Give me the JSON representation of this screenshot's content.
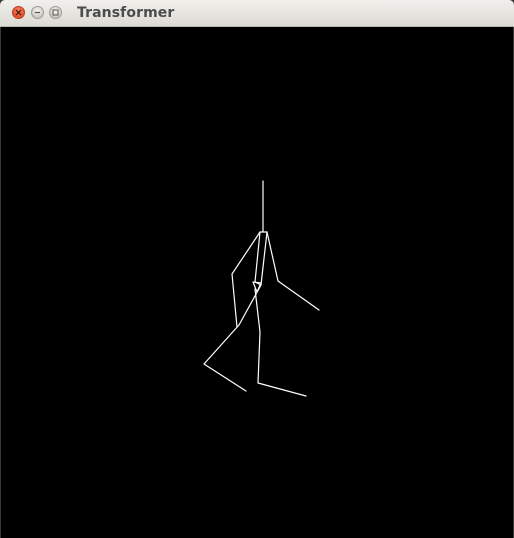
{
  "window": {
    "title": "Transformer",
    "controls": {
      "close_icon": "close-icon",
      "minimize_icon": "minimize-icon",
      "maximize_icon": "maximize-icon"
    }
  },
  "canvas": {
    "background": "#000000",
    "stroke_color": "#ffffff",
    "figure": "stick-figure"
  }
}
